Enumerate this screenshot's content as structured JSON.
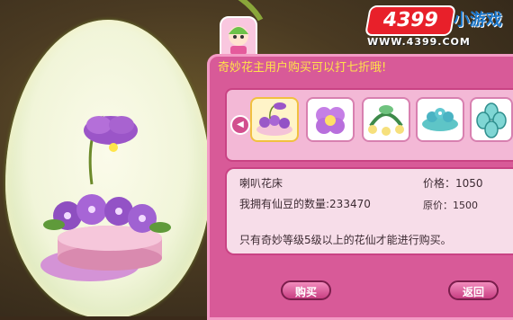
{
  "banner": "奇妙花主用户购买可以打七折哦!",
  "item": {
    "name": "喇叭花床",
    "owned_label": "我拥有仙豆的数量:233470",
    "price_label": "价格：1050",
    "original_price_label": "原价：1500",
    "notice": "只有奇妙等级5级以上的花仙才能进行购买。"
  },
  "buttons": {
    "buy": "购买",
    "back": "返回"
  },
  "logo": {
    "brand": "4399",
    "tagline": "小游戏",
    "url": "WWW.4399.COM"
  },
  "colors": {
    "panel": "#d85a98",
    "banner_text": "#ffe24a",
    "logo_red": "#e8202a",
    "logo_blue": "#1b76c9"
  },
  "shop_items": [
    {
      "icon": "flower-bed-icon",
      "selected": true
    },
    {
      "icon": "purple-flower-icon",
      "selected": false
    },
    {
      "icon": "green-vine-arch-icon",
      "selected": false
    },
    {
      "icon": "blue-flower-cluster-icon",
      "selected": false
    },
    {
      "icon": "teal-leaf-icon",
      "selected": false
    }
  ]
}
